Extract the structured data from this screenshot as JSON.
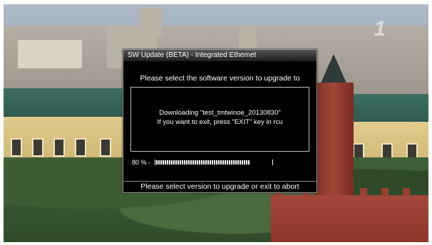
{
  "channel_logo": "1",
  "dialog": {
    "title": "SW Update (BETA) - Integrated Ethernet",
    "heading": "Please select the software version to upgrade to",
    "status_line_1": "Downloading \"test_tmtwinoe_20130830\"",
    "status_line_2": "If you want to exit, press \"EXIT\" key in rcu",
    "progress_text": "80 %  -",
    "progress_value": 80,
    "footer": "Please select version to upgrade or exit to abort"
  },
  "colors": {
    "dialog_background": "#000000",
    "text": "#ffffff",
    "border": "#bdbdbd"
  }
}
